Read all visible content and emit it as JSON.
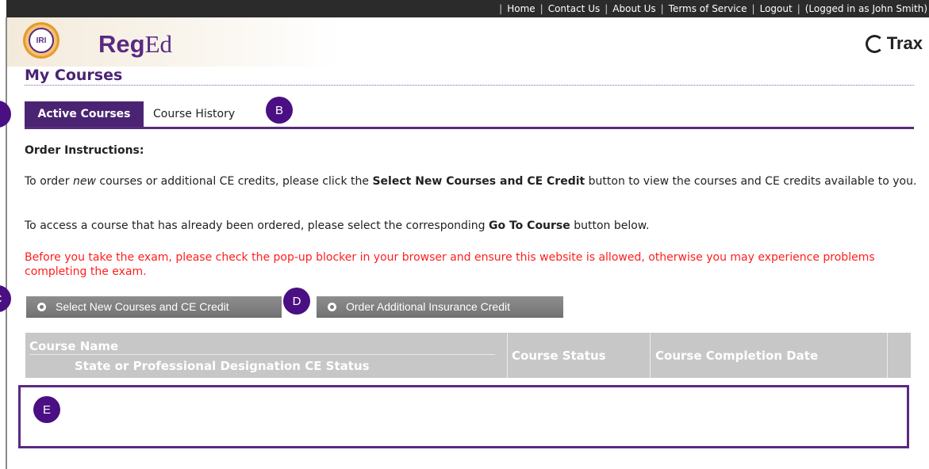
{
  "topnav": {
    "items": [
      "Home",
      "Contact Us",
      "About Us",
      "Terms of Service",
      "Logout"
    ],
    "logged_in": "(Logged in as John  Smith)"
  },
  "header": {
    "seal_text": "IRI",
    "brand_bold": "Reg",
    "brand_light": "Ed",
    "partner": "Trax"
  },
  "page": {
    "title": "My Courses"
  },
  "tabs": [
    {
      "label": "Active Courses",
      "active": true
    },
    {
      "label": "Course History",
      "active": false
    }
  ],
  "instructions": {
    "heading": "Order Instructions:",
    "p1_a": "To order ",
    "p1_em": "new",
    "p1_b": " courses or additional CE credits, please click the ",
    "p1_strong": "Select New Courses and CE Credit",
    "p1_c": " button to view the courses and CE credits available to you.",
    "p2_a": "To access a course that has already been ordered, please select the corresponding ",
    "p2_strong": "Go To Course",
    "p2_b": " button below.",
    "warning": "Before you take the exam, please check the pop-up blocker in your browser and ensure this website is allowed, otherwise you may experience problems completing the exam."
  },
  "buttons": {
    "select_new": "Select New Courses and CE Credit",
    "order_insurance": "Order Additional Insurance Credit"
  },
  "table": {
    "col_name": "Course Name",
    "col_name_sub": "State or Professional Designation CE Status",
    "col_status": "Course Status",
    "col_date": "Course Completion Date"
  },
  "callouts": [
    "B",
    "C",
    "D",
    "E"
  ],
  "colors": {
    "brand_purple": "#4a2472",
    "callout": "#4a0f82",
    "warning": "#ff1e1e",
    "button": "#7a7a7a",
    "table_header": "#c7c7c7"
  }
}
